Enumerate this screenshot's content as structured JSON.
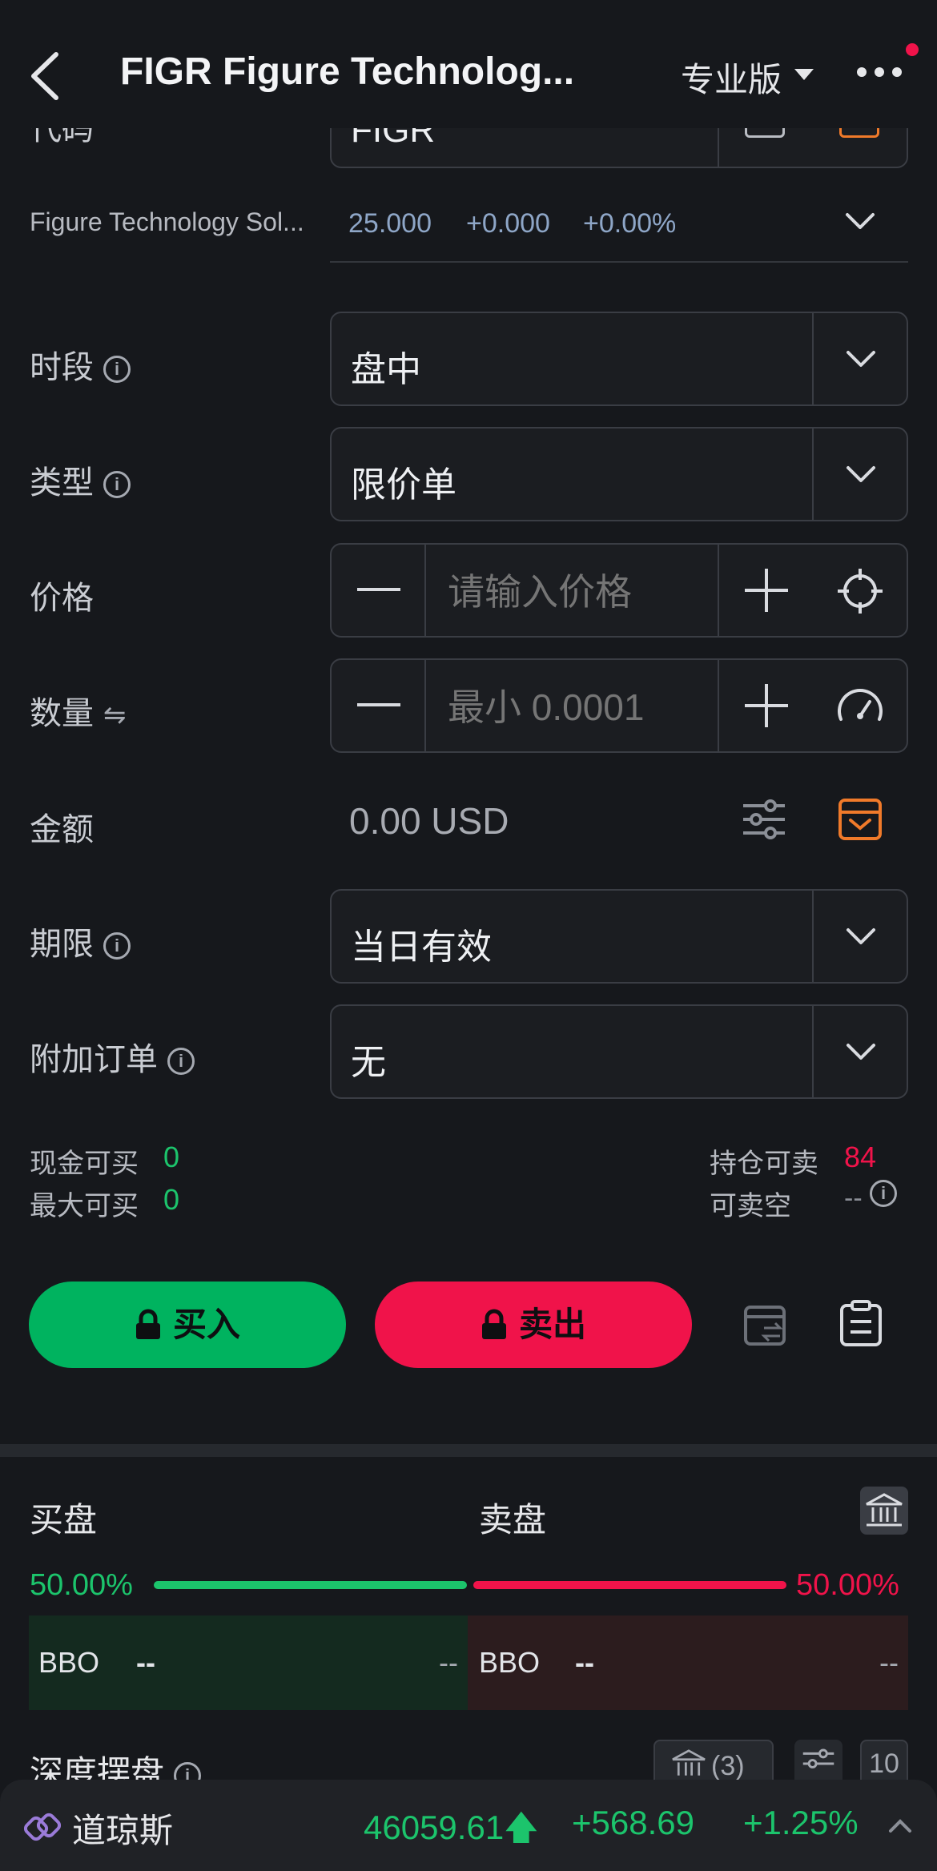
{
  "header": {
    "title": "FIGR  Figure Technolog...",
    "pro_label": "专业版"
  },
  "code_row": {
    "label": "代码",
    "value": "FIGR"
  },
  "stock": {
    "name": "Figure Technology Sol...",
    "price": "25.000",
    "change": "+0.000",
    "change_pct": "+0.00%"
  },
  "form": {
    "session": {
      "label": "时段",
      "value": "盘中"
    },
    "type": {
      "label": "类型",
      "value": "限价单"
    },
    "price": {
      "label": "价格",
      "placeholder": "请输入价格"
    },
    "quantity": {
      "label": "数量",
      "placeholder": "最小 0.0001"
    },
    "amount": {
      "label": "金额",
      "value": "0.00 USD"
    },
    "validity": {
      "label": "期限",
      "value": "当日有效"
    },
    "attached": {
      "label": "附加订单",
      "value": "无"
    }
  },
  "account": {
    "cash_buy_label": "现金可买",
    "cash_buy_value": "0",
    "max_buy_label": "最大可买",
    "max_buy_value": "0",
    "position_sell_label": "持仓可卖",
    "position_sell_value": "84",
    "short_label": "可卖空",
    "short_value": "--"
  },
  "actions": {
    "buy": "买入",
    "sell": "卖出"
  },
  "orderbook": {
    "bid_title": "买盘",
    "ask_title": "卖盘",
    "bid_pct": "50.00%",
    "ask_pct": "50.00%",
    "bid_ratio": 0.5,
    "bbo_label": "BBO",
    "bid_price": "--",
    "bid_size": "--",
    "ask_price": "--",
    "ask_size": "--",
    "depth_title": "深度摆盘",
    "exchange_count": "(3)",
    "depth_levels": "10"
  },
  "ticker": {
    "name": "道琼斯",
    "value": "46059.61",
    "change": "+568.69",
    "change_pct": "+1.25%"
  },
  "colors": {
    "buy": "#00b35f",
    "sell": "#f0134a",
    "accent_orange": "#f07a2a"
  }
}
